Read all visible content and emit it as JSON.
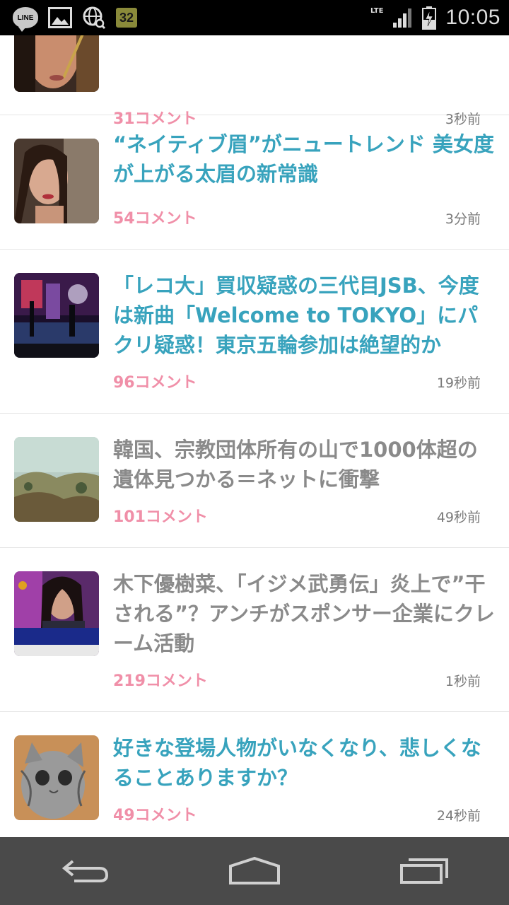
{
  "status_bar": {
    "time": "10:05",
    "network": "LTE",
    "battery_badge": "32",
    "line_label": "LINE",
    "icons": [
      "line-icon",
      "gallery-icon",
      "globe-search-icon",
      "battery-badge-icon",
      "lte-icon",
      "signal-icon",
      "battery-charging-icon"
    ]
  },
  "articles": [
    {
      "title": "",
      "comments": "31コメント",
      "time": "3秒前",
      "read": false
    },
    {
      "title": "“ネイティブ眉”がニュートレンド 美女度が上がる太眉の新常識",
      "comments": "54コメント",
      "time": "3分前",
      "read": false
    },
    {
      "title": "「レコ大」買収疑惑の三代目JSB、今度は新曲「Welcome to TOKYO」にパクリ疑惑！東京五輪参加は絶望的か",
      "comments": "96コメント",
      "time": "19秒前",
      "read": false
    },
    {
      "title": "韓国、宗教団体所有の山で1000体超の遺体見つかる＝ネットに衝撃",
      "comments": "101コメント",
      "time": "49秒前",
      "read": true
    },
    {
      "title": "木下優樹菜、「イジメ武勇伝」炎上で”干される”？アンチがスポンサー企業にクレーム活動",
      "comments": "219コメント",
      "time": "1秒前",
      "read": true
    },
    {
      "title": "好きな登場人物がいなくなり、悲しくなることありますか？",
      "comments": "49コメント",
      "time": "24秒前",
      "read": false
    }
  ],
  "nav_bar": {
    "icons": [
      "back-icon",
      "home-icon",
      "recent-apps-icon"
    ]
  },
  "colors": {
    "title_unread": "#38a3bd",
    "title_read": "#8a8a8a",
    "comments": "#f08fa8",
    "status_bar_bg": "#000000",
    "nav_bar_bg": "#4a4a4a"
  }
}
